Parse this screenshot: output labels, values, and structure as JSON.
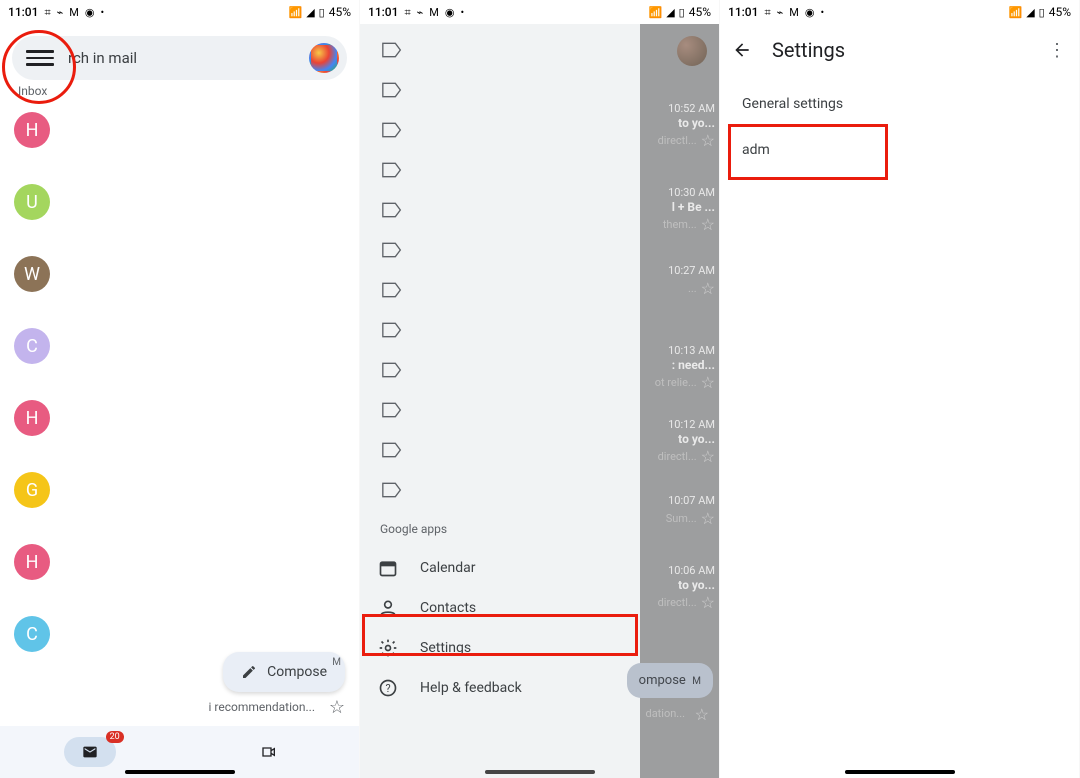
{
  "statusbar": {
    "time": "11:01",
    "battery": "45%",
    "icons": [
      "slack-icon",
      "chat-icon",
      "gmail-icon",
      "maps-icon",
      "dot-icon"
    ],
    "right_icons": [
      "wifi-icon",
      "signal-icon",
      "battery-icon"
    ]
  },
  "screen1": {
    "search_placeholder": "Search in mail",
    "search_visible": "rch in mail",
    "section": "Inbox",
    "senders": [
      {
        "initial": "H",
        "color": "c-pink"
      },
      {
        "initial": "U",
        "color": "c-green"
      },
      {
        "initial": "W",
        "color": "c-brown"
      },
      {
        "initial": "C",
        "color": "c-lilac"
      },
      {
        "initial": "H",
        "color": "c-pink"
      },
      {
        "initial": "G",
        "color": "c-yellow"
      },
      {
        "initial": "H",
        "color": "c-pink"
      },
      {
        "initial": "C",
        "color": "c-cyan"
      }
    ],
    "compose": "Compose",
    "snippet": "i recommendation...",
    "bottom_badge": "20",
    "tabs": [
      "mail-tab",
      "meet-tab"
    ],
    "tab_marker": "M"
  },
  "screen2": {
    "labels_count": 12,
    "section": "Google apps",
    "items": [
      {
        "icon": "calendar-icon",
        "label": "Calendar"
      },
      {
        "icon": "contacts-icon",
        "label": "Contacts"
      },
      {
        "icon": "settings-icon",
        "label": "Settings"
      },
      {
        "icon": "help-icon",
        "label": "Help & feedback"
      }
    ],
    "compose_peek": "ompose",
    "peek_tab": "M",
    "mails": [
      {
        "time": "10:52 AM",
        "line1": "to yo...",
        "line2": "directl..."
      },
      {
        "time": "10:30 AM",
        "line1": "l + Be ...",
        "line2": "them..."
      },
      {
        "time": "10:27 AM",
        "line1": "",
        "line2": "..."
      },
      {
        "time": "10:13 AM",
        "line1": ": need...",
        "line2": "ot relie..."
      },
      {
        "time": "10:12 AM",
        "line1": "to yo...",
        "line2": "directl..."
      },
      {
        "time": "10:07 AM",
        "line1": "",
        "line2": "Sum..."
      },
      {
        "time": "10:06 AM",
        "line1": "to yo...",
        "line2": "directl..."
      }
    ],
    "bottom_snip": "dation..."
  },
  "screen3": {
    "title": "Settings",
    "item1": "General settings",
    "item2": "adm"
  }
}
